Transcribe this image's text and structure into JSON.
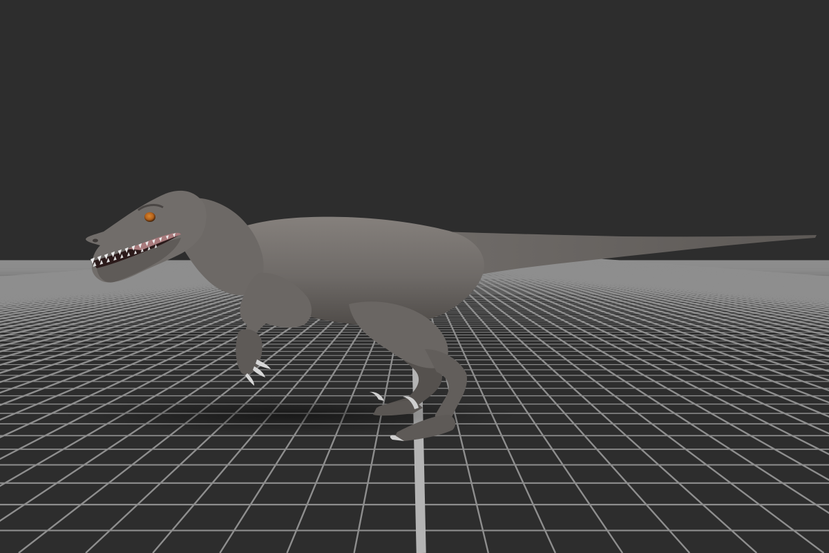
{
  "viewport": {
    "background_color": "#2d2d2d",
    "grid_color": "#8e8e8e",
    "axis_line_color": "#b4b4b4",
    "show_grid": true
  },
  "model": {
    "kind": "raptor-dinosaur",
    "skin_color": "#6e6a67",
    "eye_color": "#b4621c",
    "claw_color": "#cfcfcf",
    "pose": "walking"
  }
}
